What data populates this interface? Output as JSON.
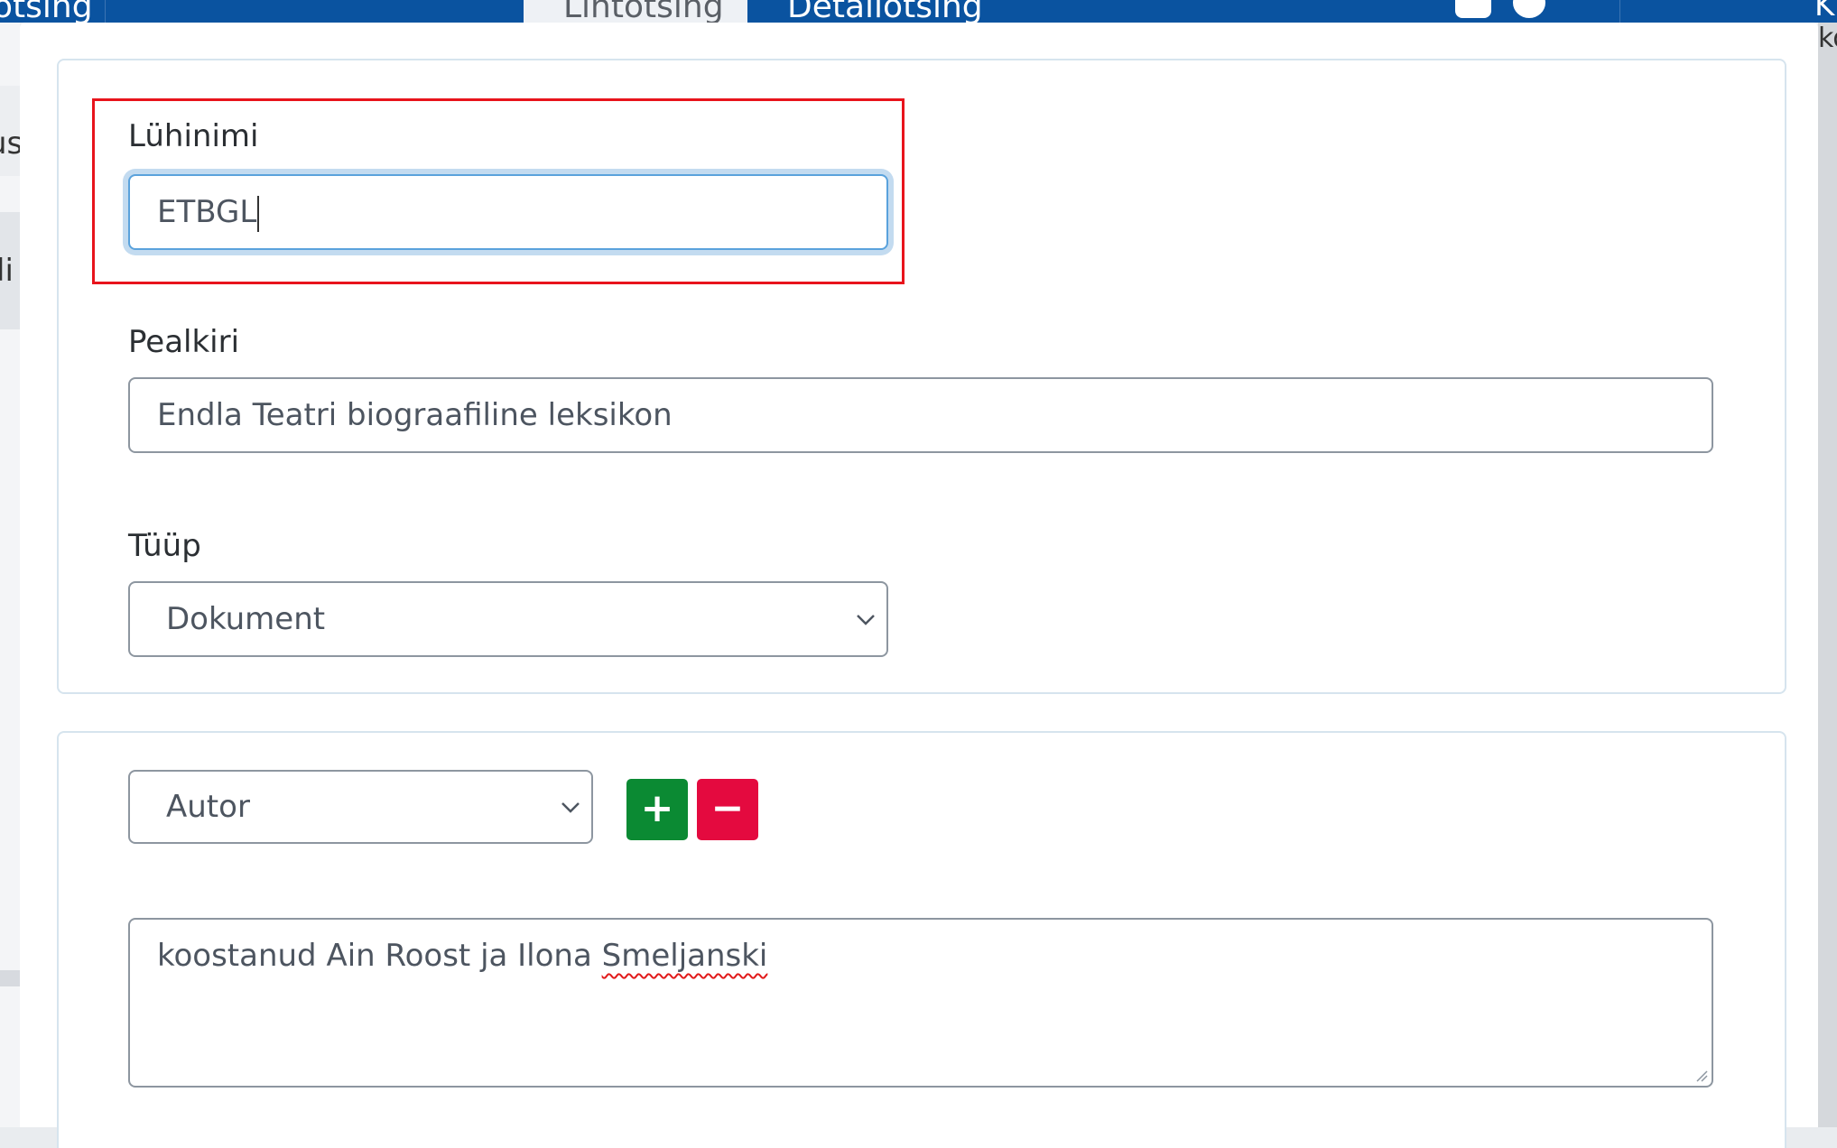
{
  "topbar": {
    "nav_left": "otsing",
    "tab_simple_search": "Lihtotsing",
    "tab_detail_search": "Detailotsing",
    "right_fragment": "K",
    "right_fragment_2": "ko"
  },
  "background": {
    "left_fragment_1": "us",
    "left_fragment_2": "li"
  },
  "form": {
    "short_name": {
      "label": "Lühinimi",
      "value": "ETBGL"
    },
    "title": {
      "label": "Pealkiri",
      "value": "Endla Teatri biograafiline leksikon"
    },
    "type": {
      "label": "Tüüp",
      "selected": "Dokument"
    },
    "contributor": {
      "role_selected": "Autor",
      "add_label": "+",
      "remove_label": "−",
      "text_before": "koostanud Ain Roost ja Ilona ",
      "text_misspelled": "Smeljanski"
    }
  },
  "colors": {
    "brand_blue": "#0a53a0",
    "highlight_red": "#e8141c",
    "add_green": "#0b8a33",
    "remove_red": "#e40a3f",
    "focus_blue": "#5aa2dc"
  }
}
